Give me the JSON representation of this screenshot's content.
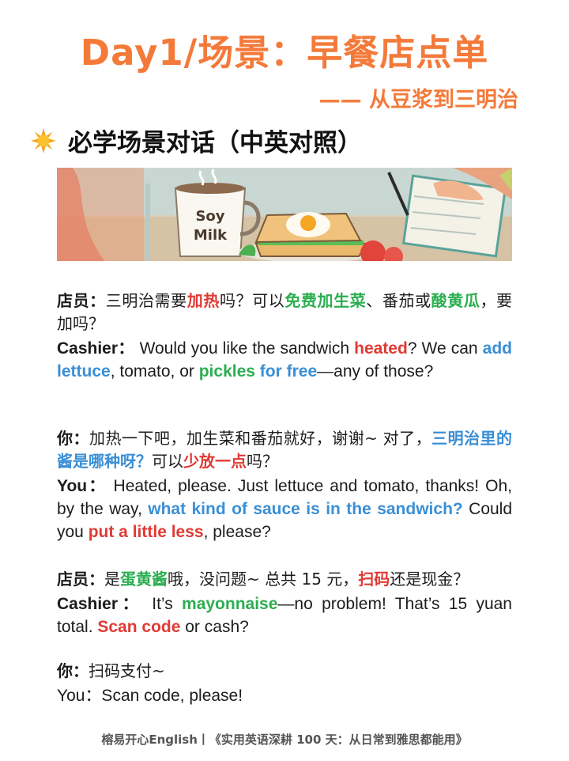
{
  "title": "Day1/场景：早餐店点单",
  "subtitle": "—— 从豆浆到三明治",
  "section": {
    "label": "必学场景对话（中英对照）"
  },
  "banner": {
    "cup_text_1": "Soy",
    "cup_text_2": "Milk"
  },
  "block1": {
    "cn": [
      "店员：",
      "三明治需要",
      "加热",
      "吗？可以",
      "免费",
      "加生菜",
      "、番茄或",
      "酸黄瓜",
      "，要加吗？"
    ],
    "en": [
      "Cashier：",
      "Would you like the sandwich ",
      "heated",
      "? We can ",
      "add lettuce",
      ", tomato, or ",
      "pickles",
      " ",
      "for free",
      "—any of those?"
    ]
  },
  "block2": {
    "cn": [
      "你：",
      "加热一下吧，加生菜和番茄就好，谢谢~ 对了，",
      "三明治里的酱是哪种呀？",
      "可以",
      "少放一点",
      "吗？"
    ],
    "en": [
      "You：",
      "Heated, please. Just lettuce and tomato, thanks! Oh, by the way, ",
      "what kind of sauce is in the sandwich?",
      " Could you ",
      "put a little less",
      ", please?"
    ]
  },
  "block3": {
    "cn": [
      "店员：",
      "是",
      "蛋黄酱",
      "哦，没问题~ 总共 15 元，",
      "扫码",
      "还是现金？"
    ],
    "en": [
      "Cashier：",
      "It’s ",
      "mayonnaise",
      "—no problem! That’s 15 yuan total. ",
      "Scan code",
      " or cash?"
    ]
  },
  "block4": {
    "cn": [
      "你：",
      "扫码支付~"
    ],
    "en": [
      "You",
      "：Scan code, please!"
    ]
  },
  "footer": "榕易开心English丨《实用英语深耕 100 天：从日常到雅思都能用》",
  "colors": {
    "accent": "#f47a3a",
    "red": "#e03a34",
    "green": "#2cae51",
    "blue": "#3a8fd6"
  }
}
